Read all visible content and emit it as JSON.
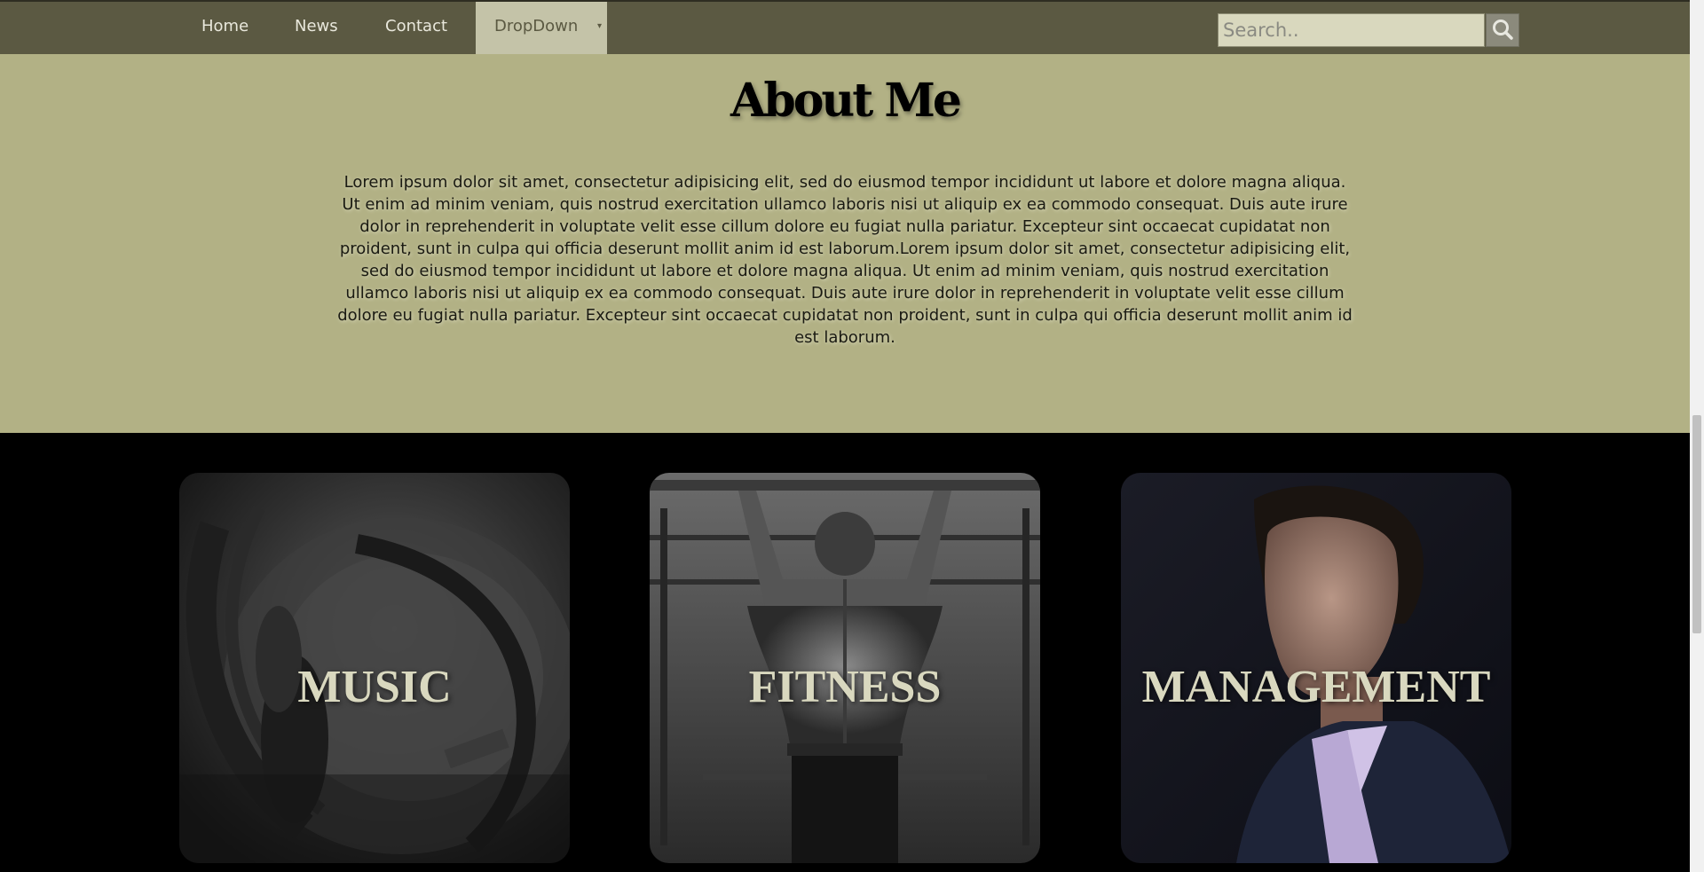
{
  "nav": {
    "items": [
      {
        "label": "Home"
      },
      {
        "label": "News"
      },
      {
        "label": "Contact"
      }
    ],
    "dropdown": {
      "label": "DropDown",
      "caret": "▾"
    },
    "search": {
      "placeholder": "Search..",
      "value": "",
      "icon": "search-icon"
    }
  },
  "about": {
    "title": "About Me",
    "text": "Lorem ipsum dolor sit amet, consectetur adipisicing elit, sed do eiusmod tempor incididunt ut labore et dolore magna aliqua. Ut enim ad minim veniam, quis nostrud exercitation ullamco laboris nisi ut aliquip ex ea commodo consequat. Duis aute irure dolor in reprehenderit in voluptate velit esse cillum dolore eu fugiat nulla pariatur. Excepteur sint occaecat cupidatat non proident, sunt in culpa qui officia deserunt mollit anim id est laborum.Lorem ipsum dolor sit amet, consectetur adipisicing elit, sed do eiusmod tempor incididunt ut labore et dolore magna aliqua. Ut enim ad minim veniam, quis nostrud exercitation ullamco laboris nisi ut aliquip ex ea commodo consequat. Duis aute irure dolor in reprehenderit in voluptate velit esse cillum dolore eu fugiat nulla pariatur. Excepteur sint occaecat cupidatat non proident, sunt in culpa qui officia deserunt mollit anim id est laborum."
  },
  "cards": [
    {
      "label": "MUSIC",
      "image": "headphones-photo"
    },
    {
      "label": "FITNESS",
      "image": "pull-up-athlete-photo"
    },
    {
      "label": "MANAGEMENT",
      "image": "businessman-portrait-photo"
    }
  ],
  "colors": {
    "navbar": "#5b5942",
    "dropdown_active": "#c4c3a8",
    "about_bg": "#b2b185",
    "card_label": "#d9d8bf",
    "search_bg": "#d9d8be"
  }
}
